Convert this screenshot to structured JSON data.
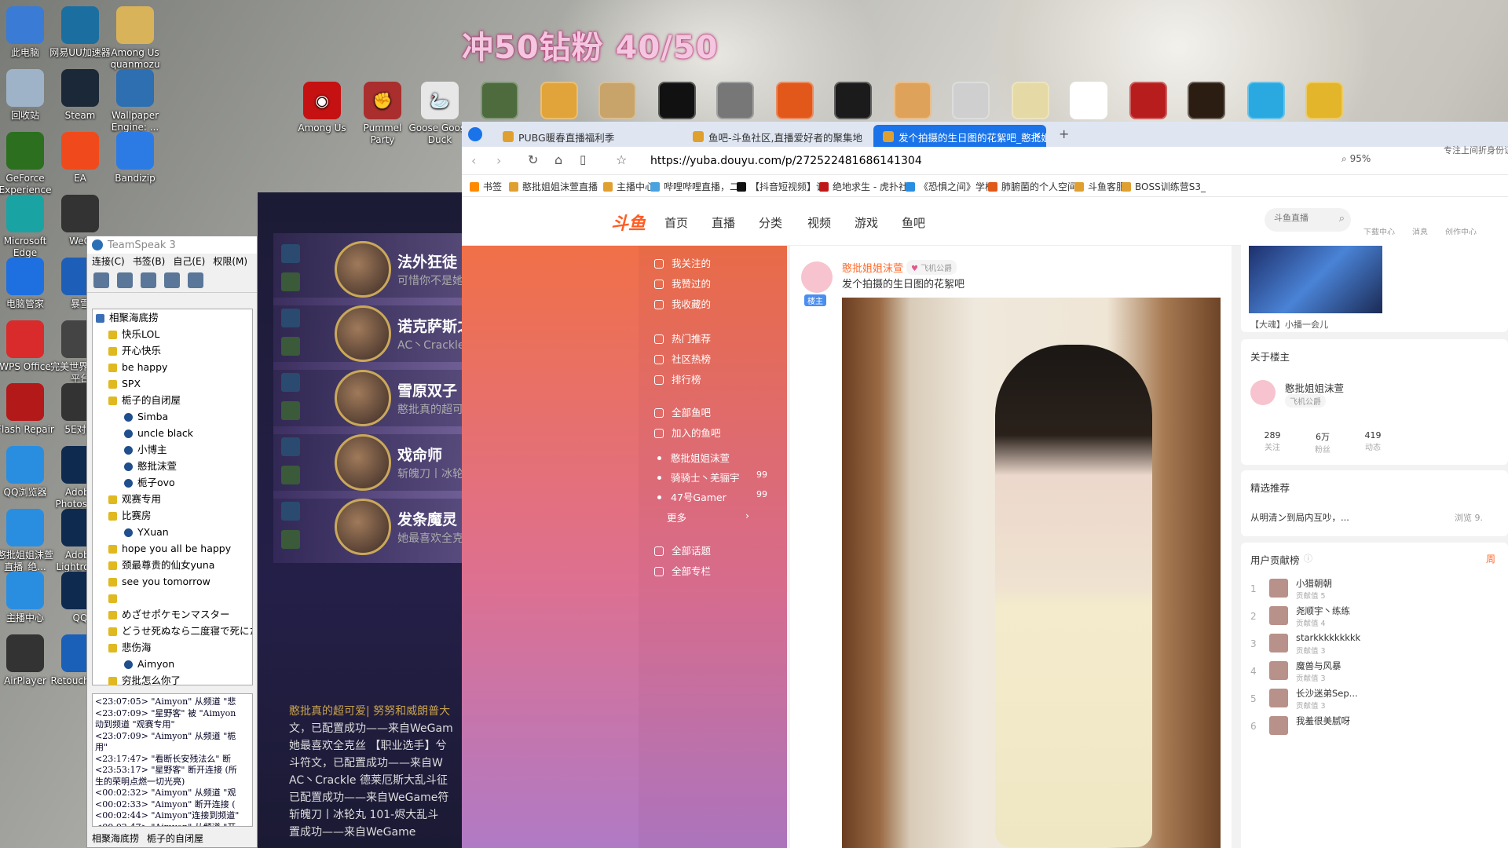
{
  "banner": "冲50钻粉 40/50",
  "desktop_icons": [
    {
      "label": "此电脑",
      "name": "this-pc-icon",
      "color": "#3a7bd5"
    },
    {
      "label": "网易UU加速器",
      "name": "uu-accelerator-icon",
      "color": "#1a6fa0"
    },
    {
      "label": "Among Us quanmozu",
      "name": "among-us-folder-icon",
      "color": "#d9b35a"
    },
    {
      "label": "回收站",
      "name": "recycle-bin-icon",
      "color": "#9fb3c8"
    },
    {
      "label": "Steam",
      "name": "steam-icon",
      "color": "#1b2838"
    },
    {
      "label": "Wallpaper Engine: ...",
      "name": "wallpaper-engine-icon",
      "color": "#2d6fb0"
    },
    {
      "label": "GeForce Experience",
      "name": "geforce-icon",
      "color": "#2b6f1f"
    },
    {
      "label": "EA",
      "name": "ea-icon",
      "color": "#f04a1c"
    },
    {
      "label": "Bandizip",
      "name": "bandizip-icon",
      "color": "#2c7be5"
    },
    {
      "label": "Microsoft Edge",
      "name": "edge-icon",
      "color": "#1aa3a3"
    },
    {
      "label": "WeG",
      "name": "wegame-icon",
      "color": "#333"
    },
    {
      "label": "电脑管家",
      "name": "pc-manager-icon",
      "color": "#1e6fe0"
    },
    {
      "label": "暴雪",
      "name": "blizzard-icon",
      "color": "#1d5fb8"
    },
    {
      "label": "WPS Office",
      "name": "wps-icon",
      "color": "#d92b2b"
    },
    {
      "label": "完美世界 对战平台",
      "name": "perfect-world-icon",
      "color": "#444"
    },
    {
      "label": "Flash Repair",
      "name": "flash-repair-icon",
      "color": "#b31919"
    },
    {
      "label": "5E对战",
      "name": "5e-icon",
      "color": "#333"
    },
    {
      "label": "QQ浏览器",
      "name": "qq-browser-icon",
      "color": "#2a8ee0"
    },
    {
      "label": "Adobe Photoshop",
      "name": "photoshop-icon",
      "color": "#0f2a4f"
    },
    {
      "label": "憨批姐姐沫萱直播_绝...",
      "name": "stream-shortcut-icon",
      "color": "#2a8ee0"
    },
    {
      "label": "Adobe Lightroom",
      "name": "lightroom-icon",
      "color": "#0f2a4f"
    },
    {
      "label": "主播中心",
      "name": "streamer-center-icon",
      "color": "#2a8ee0"
    },
    {
      "label": "QQ",
      "name": "qq-icon",
      "color": "#0f2a4f"
    },
    {
      "label": "AirPlayer",
      "name": "airplayer-icon",
      "color": "#333"
    },
    {
      "label": "Retouch Eye",
      "name": "retouch-icon",
      "color": "#1a5fb8"
    }
  ],
  "top_icons": [
    {
      "label": "Among Us",
      "name": "among-us-icon",
      "color": "#c51111"
    },
    {
      "label": "Pummel Party",
      "name": "pummel-party-icon",
      "color": "#b33"
    },
    {
      "label": "Goose Goose Duck",
      "name": "goose-goose-duck-icon",
      "color": "#ddd"
    }
  ],
  "teamspeak": {
    "title": "TeamSpeak 3",
    "menu": [
      "连接(C)",
      "书签(B)",
      "自己(E)",
      "权限(M)"
    ],
    "server": "相聚海底捞",
    "channels": [
      {
        "label": "快乐LOL",
        "type": "channel"
      },
      {
        "label": "开心快乐",
        "type": "channel"
      },
      {
        "label": "be happy",
        "type": "channel"
      },
      {
        "label": "SPX",
        "type": "channel"
      },
      {
        "label": "栀子的自闭屋",
        "type": "channel"
      },
      {
        "label": "Simba",
        "type": "user"
      },
      {
        "label": "uncle black",
        "type": "user"
      },
      {
        "label": "小博主",
        "type": "user"
      },
      {
        "label": "憨批沫萱",
        "type": "user"
      },
      {
        "label": "栀子ovo",
        "type": "user"
      },
      {
        "label": "观赛专用",
        "type": "channel"
      },
      {
        "label": "比赛房",
        "type": "channel"
      },
      {
        "label": "YXuan",
        "type": "user"
      },
      {
        "label": "hope you all be happy",
        "type": "channel"
      },
      {
        "label": "颈最尊贵的仙女yuna",
        "type": "channel"
      },
      {
        "label": "see you tomorrow",
        "type": "channel"
      },
      {
        "label": "",
        "type": "channel"
      },
      {
        "label": "めざせポケモンマスター",
        "type": "channel"
      },
      {
        "label": "どうせ死ぬなら二度寝で死にた",
        "type": "channel"
      },
      {
        "label": "悲伤海",
        "type": "channel"
      },
      {
        "label": "Aimyon",
        "type": "user"
      },
      {
        "label": "穷批怎么你了",
        "type": "channel"
      }
    ],
    "log": [
      "<23:07:05> \"Aimyon\" 从频道 \"悲",
      "<23:07:09> \"星野客\" 被 \"Aimyon",
      "动到频道 \"观赛专用\"",
      "<23:07:09> \"Aimyon\" 从频道 \"栀",
      "用\"",
      "<23:17:47> \"看断长安残法么\" 断",
      "<23:53:17> \"星野客\" 断开连接 (所",
      "生的荣明点燃一切光亮)",
      "<00:02:32> \"Aimyon\" 从频道 \"观",
      "<00:02:33> \"Aimyon\" 断开连接 (",
      "<00:02:44> \"Aimyon\"连接到频道\"",
      "<00:02:47> \"Aimyon\" 从频道 \"开"
    ],
    "tabs": [
      "相聚海底捞",
      "栀子的自闭屋"
    ]
  },
  "game": {
    "heroes": [
      {
        "name": "法外狂徒",
        "sub": "可惜你不是她"
      },
      {
        "name": "诺克萨斯之手",
        "sub": "AC丶Crackle"
      },
      {
        "name": "雪原双子",
        "sub": "憨批真的超可爱"
      },
      {
        "name": "戏命师",
        "sub": "斩魄刀丨冰轮"
      },
      {
        "name": "发条魔灵",
        "sub": "她最喜欢全克"
      }
    ],
    "messages": [
      "憨批真的超可爱| 努努和威朗普大",
      "文，已配置成功——来自WeGam",
      "她最喜欢全克丝 【职业选手】兮",
      "斗符文，已配置成功——来自W",
      "AC丶Crackle 德莱厄斯大乱斗征",
      "已配置成功——来自WeGame符",
      "斩魄刀丨冰轮丸 101-烬大乱斗",
      "置成功——来自WeGame"
    ]
  },
  "browser": {
    "tabs": [
      {
        "title": "PUBG暖春直播福利季",
        "active": false
      },
      {
        "title": "鱼吧-斗鱼社区,直播爱好者的聚集地",
        "active": false
      },
      {
        "title": "发个拍摄的生日图的花絮吧_憨批姐",
        "active": true
      }
    ],
    "url": "https://yuba.douyu.com/p/272522481686141304",
    "zoom": "95%",
    "top_right_text": "专注上间折身份证核冲逞",
    "bookmarks": [
      "书签",
      "憨批姐姐沫萱直播",
      "主播中心",
      "哔哩哔哩直播，二",
      "【抖音短视频】记",
      "绝地求生 - 虎扑社",
      "《恐惧之间》学校",
      "肺腑菌的个人空间",
      "斗鱼客服",
      "BOSS训练营S3_"
    ],
    "site": {
      "logo": "斗鱼",
      "nav": [
        "首页",
        "直播",
        "分类",
        "视频",
        "游戏",
        "鱼吧"
      ],
      "search_placeholder": "斗鱼直播",
      "header_icons": [
        "下载中心",
        "消息",
        "创作中心"
      ]
    },
    "left_menu": {
      "group1": [
        "我关注的",
        "我赞过的",
        "我收藏的"
      ],
      "group2": [
        "热门推荐",
        "社区热榜",
        "排行榜"
      ],
      "group3": [
        "全部鱼吧",
        "加入的鱼吧"
      ],
      "bars": [
        {
          "name": "憨批姐姐沫萱",
          "count": ""
        },
        {
          "name": "骑骑士丶羌骊宇",
          "count": "99"
        },
        {
          "name": "47号Gamer",
          "count": "99"
        }
      ],
      "more": "更多",
      "group4": [
        "全部话题",
        "全部专栏"
      ]
    },
    "post": {
      "author": "憨批姐姐沫萱",
      "badge": "飞机公爵",
      "role": "楼主",
      "title": "发个拍摄的生日图的花絮吧"
    },
    "sidebar": {
      "live_caption": "【大魂】小播一会儿",
      "about_title": "关于楼主",
      "about_name": "憨批姐姐沫萱",
      "about_badge": "飞机公爵",
      "stats": [
        {
          "value": "289",
          "label": "关注"
        },
        {
          "value": "6万",
          "label": "粉丝"
        },
        {
          "value": "419",
          "label": "动态"
        }
      ],
      "rec_title": "精选推荐",
      "rec_item": "从明清ン到局内互吵，...",
      "rec_views": "浏览 9.",
      "contrib_title": "用户贡献榜",
      "contrib_tab": "周",
      "contributors": [
        {
          "rank": "1",
          "name": "小猎朝朝",
          "score": "贡献值 5"
        },
        {
          "rank": "2",
          "name": "尧顺宇丶练练",
          "score": "贡献值 4"
        },
        {
          "rank": "3",
          "name": "starkkkkkkkkk",
          "score": "贡献值 3"
        },
        {
          "rank": "4",
          "name": "魔兽与风暴",
          "score": "贡献值 3"
        },
        {
          "rank": "5",
          "name": "长沙迷弟Sep...",
          "score": "贡献值 3"
        },
        {
          "rank": "6",
          "name": "我羞很美腻呀",
          "score": ""
        }
      ]
    }
  }
}
